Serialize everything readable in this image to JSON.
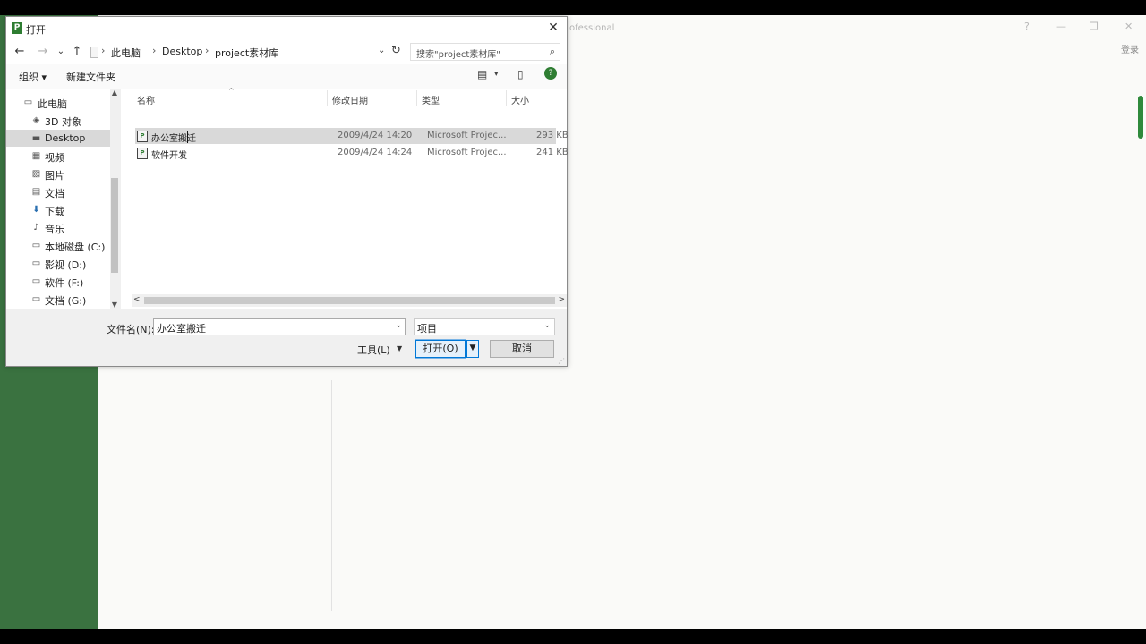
{
  "background_app": {
    "title_fragment": "ofessional",
    "window_controls": [
      "?",
      "—",
      "❐",
      "✕"
    ],
    "login_label": "登录",
    "accent_color": "#3a7240"
  },
  "dialog": {
    "title": "打开",
    "app_icon_glyph": "P",
    "close_glyph": "✕",
    "nav": {
      "back": "←",
      "forward": "→",
      "recent": "⌄",
      "up": "↑",
      "breadcrumb": [
        "此电脑",
        "Desktop",
        "project素材库"
      ],
      "crumb_separator": "›",
      "dropdown_glyph": "⌄",
      "refresh_glyph": "↻"
    },
    "search": {
      "placeholder": "搜索\"project素材库\"",
      "icon": "⌕"
    },
    "toolbar": {
      "organize_label": "组织 ▾",
      "new_folder_label": "新建文件夹",
      "view_glyph": "▤",
      "view_drop": "▾",
      "preview_glyph": "▯",
      "help_glyph": "?"
    },
    "nav_pane": {
      "items": [
        {
          "label": "此电脑",
          "icon": "computer-icon",
          "glyph": "▭"
        },
        {
          "label": "3D 对象",
          "icon": "cube-icon",
          "glyph": "◈"
        },
        {
          "label": "Desktop",
          "icon": "desktop-icon",
          "glyph": "▬",
          "selected": true
        },
        {
          "label": "视频",
          "icon": "video-icon",
          "glyph": "▦"
        },
        {
          "label": "图片",
          "icon": "image-icon",
          "glyph": "▨"
        },
        {
          "label": "文档",
          "icon": "document-icon",
          "glyph": "▤"
        },
        {
          "label": "下载",
          "icon": "download-icon",
          "glyph": "⬇"
        },
        {
          "label": "音乐",
          "icon": "music-icon",
          "glyph": "♪"
        },
        {
          "label": "本地磁盘 (C:)",
          "icon": "drive-icon",
          "glyph": "▭"
        },
        {
          "label": "影视 (D:)",
          "icon": "drive-icon",
          "glyph": "▭"
        },
        {
          "label": "软件 (F:)",
          "icon": "drive-icon",
          "glyph": "▭"
        },
        {
          "label": "文档 (G:)",
          "icon": "drive-icon",
          "glyph": "▭"
        }
      ],
      "scroll_up": "▲",
      "scroll_down": "▼"
    },
    "file_list": {
      "columns": [
        "名称",
        "修改日期",
        "类型",
        "大小"
      ],
      "sort_glyph": "^",
      "rows": [
        {
          "name": "办公室搬迁",
          "date": "2009/4/24 14:20",
          "type": "Microsoft Projec...",
          "size": "293 KB",
          "selected": true
        },
        {
          "name": "软件开发",
          "date": "2009/4/24 14:24",
          "type": "Microsoft Projec...",
          "size": "241 KB",
          "selected": false
        }
      ],
      "file_icon_glyph": "P",
      "hscroll_left": "<",
      "hscroll_right": ">"
    },
    "bottom": {
      "filename_label": "文件名(N):",
      "filename_value": "办公室搬迁",
      "filename_drop": "⌄",
      "filter_value": "项目",
      "filter_drop": "⌄",
      "tools_label": "工具(L)",
      "tools_drop": "▼",
      "open_label": "打开(O)",
      "open_split": "▼",
      "cancel_label": "取消",
      "resize_grip": "⋰"
    }
  }
}
